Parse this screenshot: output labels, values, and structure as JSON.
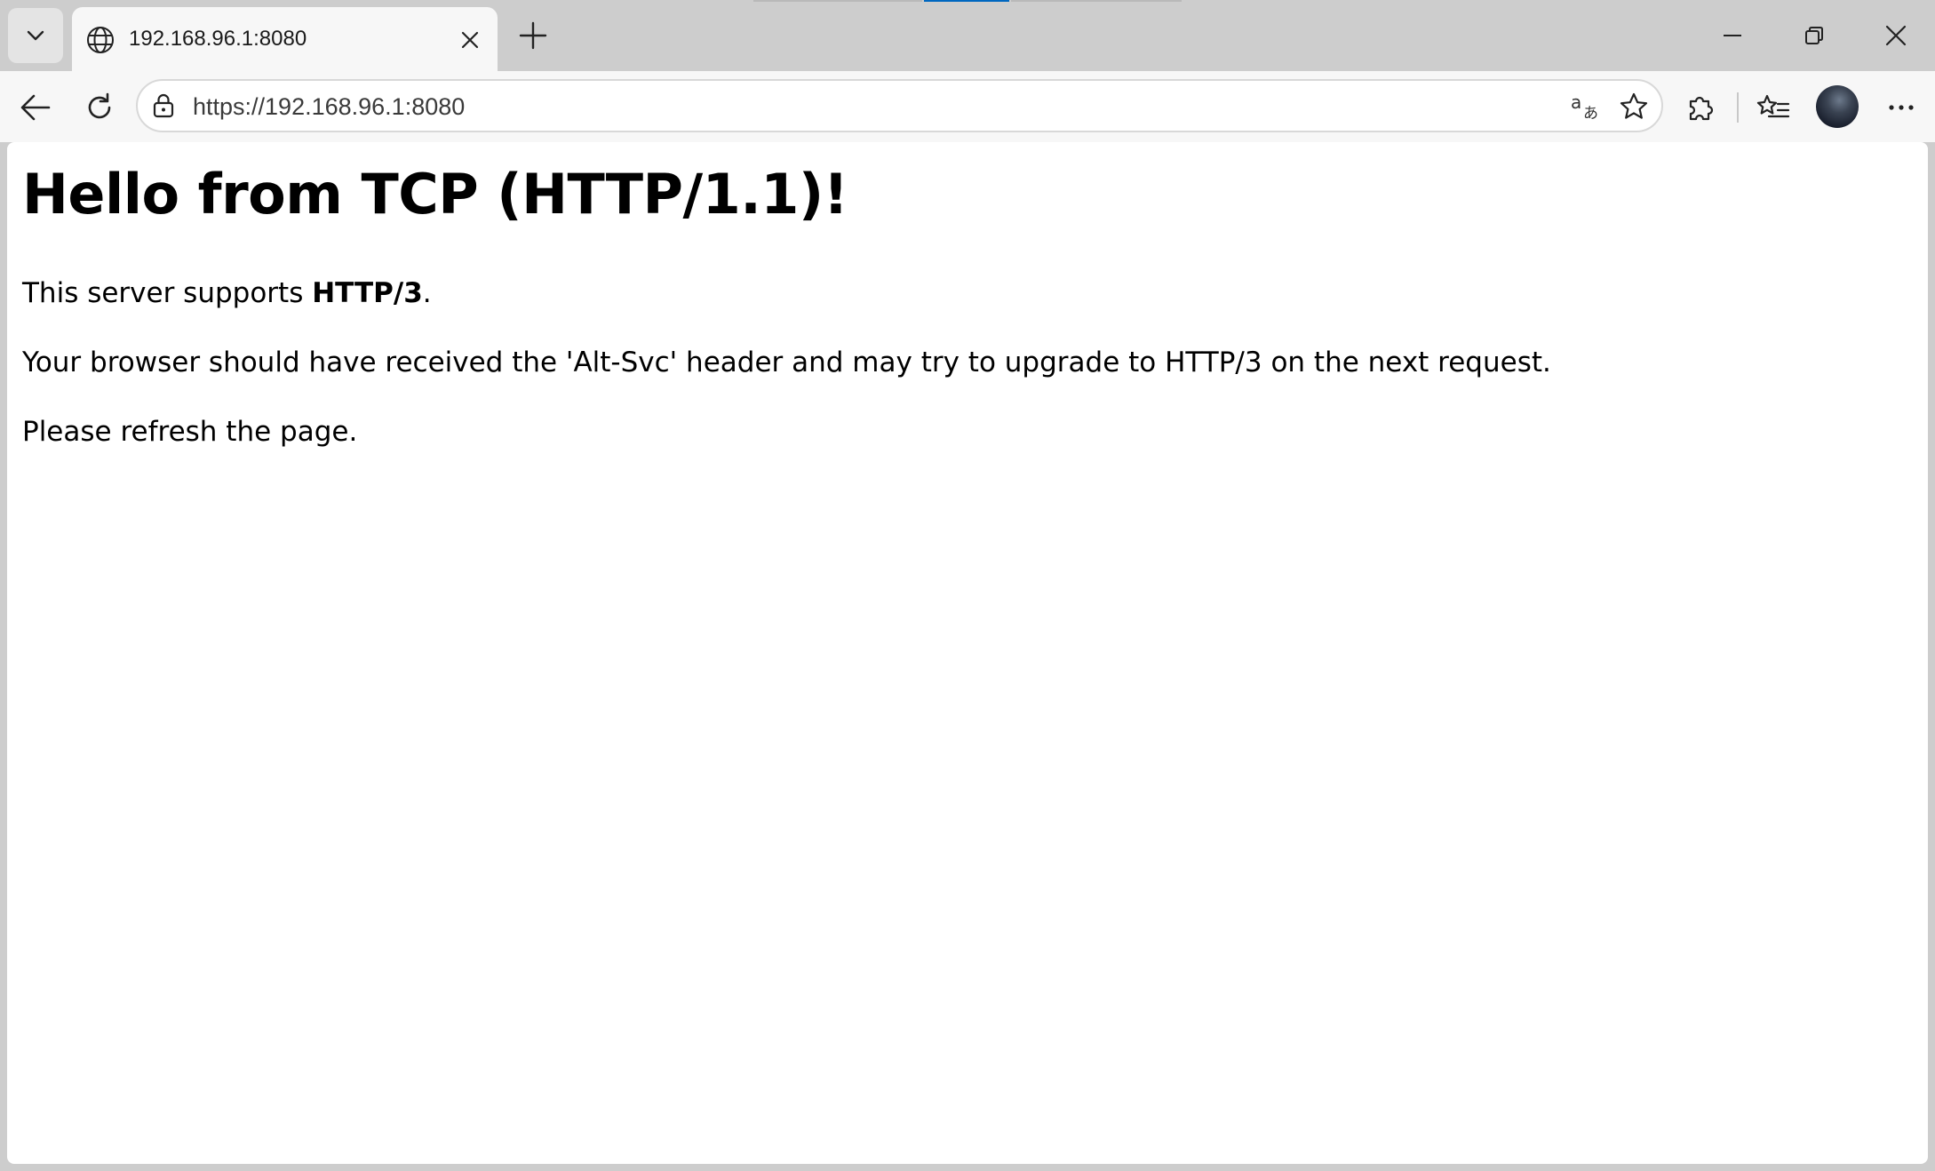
{
  "browser": {
    "tab": {
      "title": "192.168.96.1:8080",
      "favicon": "globe-icon"
    },
    "address_bar": {
      "url": "https://192.168.96.1:8080"
    },
    "icons": {
      "tab_menu": "chevron-down-icon",
      "tab_close": "close-icon",
      "new_tab": "plus-icon",
      "minimize": "minimize-icon",
      "restore": "restore-icon",
      "close_window": "close-icon",
      "back": "arrow-left-icon",
      "refresh": "refresh-icon",
      "site_info": "lock-icon",
      "translate": "translate-icon",
      "favorite": "star-icon",
      "extensions": "puzzle-icon",
      "favorites": "favorites-list-icon",
      "profile": "avatar",
      "more": "more-icon"
    },
    "colors": {
      "frame": "#cdcdcd",
      "toolbar": "#f7f7f7",
      "accent": "#0067c0"
    }
  },
  "page": {
    "heading": "Hello from TCP (HTTP/1.1)!",
    "p1": {
      "before": "This server supports ",
      "strong": "HTTP/3",
      "after": "."
    },
    "p2": "Your browser should have received the 'Alt-Svc' header and may try to upgrade to HTTP/3 on the next request.",
    "p3": "Please refresh the page."
  }
}
